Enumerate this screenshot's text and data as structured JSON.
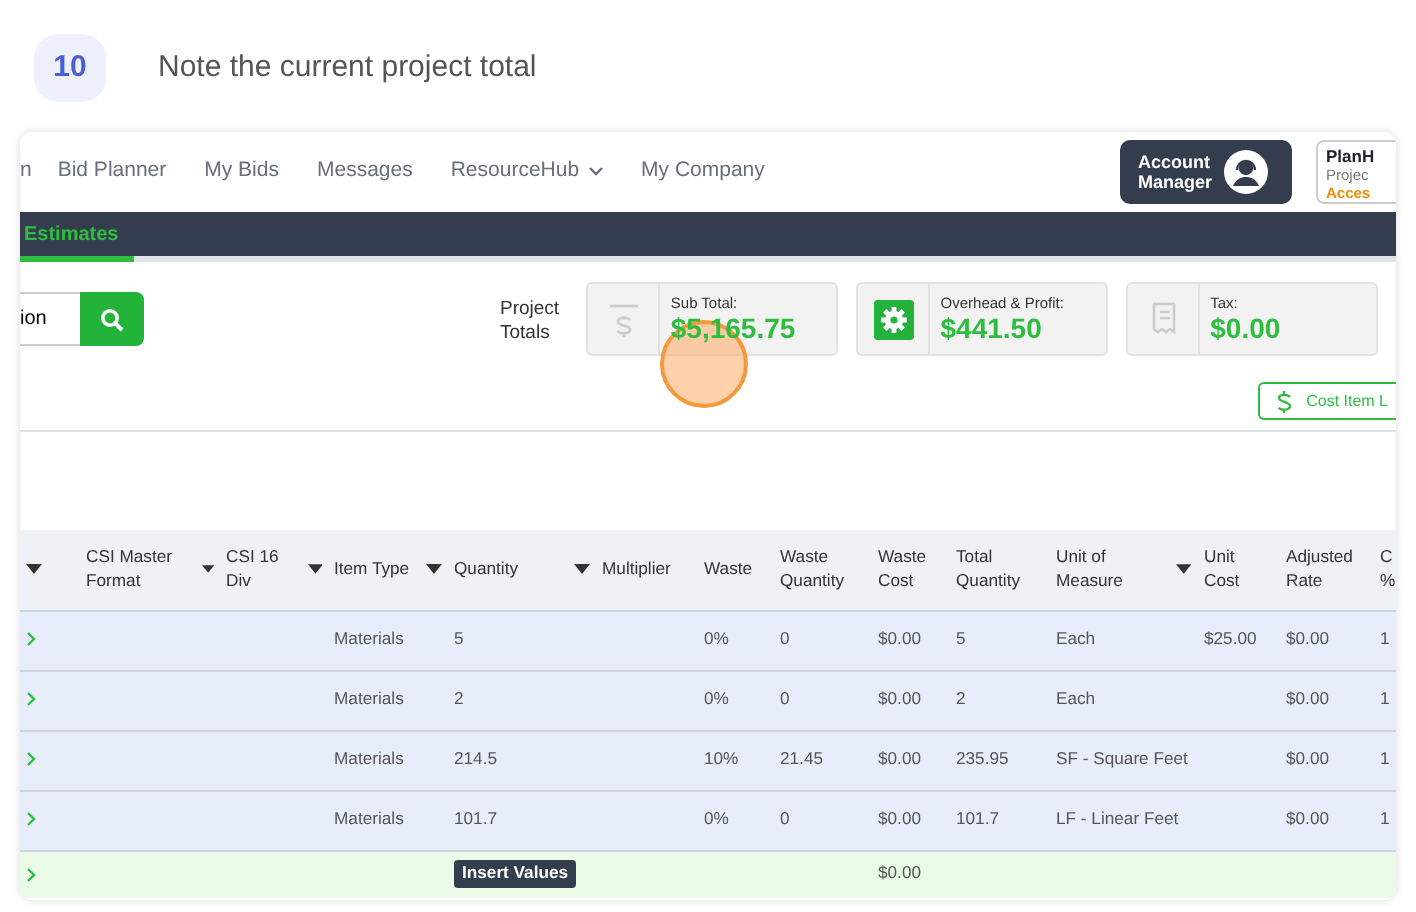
{
  "step": {
    "number": "10",
    "text": "Note the current project total"
  },
  "nav": {
    "items": [
      {
        "label": "n"
      },
      {
        "label": "Bid Planner"
      },
      {
        "label": "My Bids"
      },
      {
        "label": "Messages"
      },
      {
        "label": "ResourceHub",
        "dropdown": true
      },
      {
        "label": "My Company"
      }
    ],
    "account_button": {
      "line1": "Account",
      "line2": "Manager"
    },
    "plan_box": {
      "lines": [
        "PlanH",
        "Projec",
        "Acces"
      ]
    }
  },
  "tabs": [
    {
      "label": "Estimates",
      "selected": true
    }
  ],
  "search": {
    "value": "ion"
  },
  "totals": {
    "label": "Project Totals",
    "cards": [
      {
        "kind": "dollar",
        "label": "Sub Total:",
        "value": "$5,165.75"
      },
      {
        "kind": "gear",
        "label": "Overhead & Profit:",
        "value": "$441.50"
      },
      {
        "kind": "receipt",
        "label": "Tax:",
        "value": "$0.00"
      }
    ]
  },
  "cost_item_button": {
    "label": "Cost Item L"
  },
  "table": {
    "columns": [
      {
        "sortable": true
      },
      {
        "label": "CSI Master Format",
        "sortable": true
      },
      {
        "label": "CSI 16 Div",
        "sortable": true
      },
      {
        "label": "Item Type",
        "sortable": true
      },
      {
        "label": "Quantity",
        "sortable": true
      },
      {
        "label": "Multiplier"
      },
      {
        "label": "Waste"
      },
      {
        "label": "Waste Quantity"
      },
      {
        "label": "Waste Cost"
      },
      {
        "label": "Total Quantity"
      },
      {
        "label": "Unit of Measure",
        "sortable": true
      },
      {
        "label": "Unit Cost"
      },
      {
        "label": "Adjusted Rate"
      },
      {
        "label": "C %"
      }
    ],
    "rows": [
      {
        "cells": [
          null,
          null,
          null,
          "Materials",
          "5",
          null,
          "0%",
          "0",
          "$0.00",
          "5",
          "Each",
          "$25.00",
          "$0.00",
          "1"
        ]
      },
      {
        "cells": [
          null,
          null,
          null,
          "Materials",
          "2",
          null,
          "0%",
          "0",
          "$0.00",
          "2",
          "Each",
          null,
          "$0.00",
          "1"
        ]
      },
      {
        "cells": [
          null,
          null,
          null,
          "Materials",
          "214.5",
          null,
          "10%",
          "21.45",
          "$0.00",
          "235.95",
          "SF - Square Feet",
          null,
          "$0.00",
          "1"
        ]
      },
      {
        "cells": [
          null,
          null,
          null,
          "Materials",
          "101.7",
          null,
          "0%",
          "0",
          "$0.00",
          "101.7",
          "LF - Linear Feet",
          null,
          "$0.00",
          "1"
        ]
      }
    ],
    "footer": {
      "insert_button": "Insert Values",
      "waste_cost": "$0.00"
    }
  }
}
